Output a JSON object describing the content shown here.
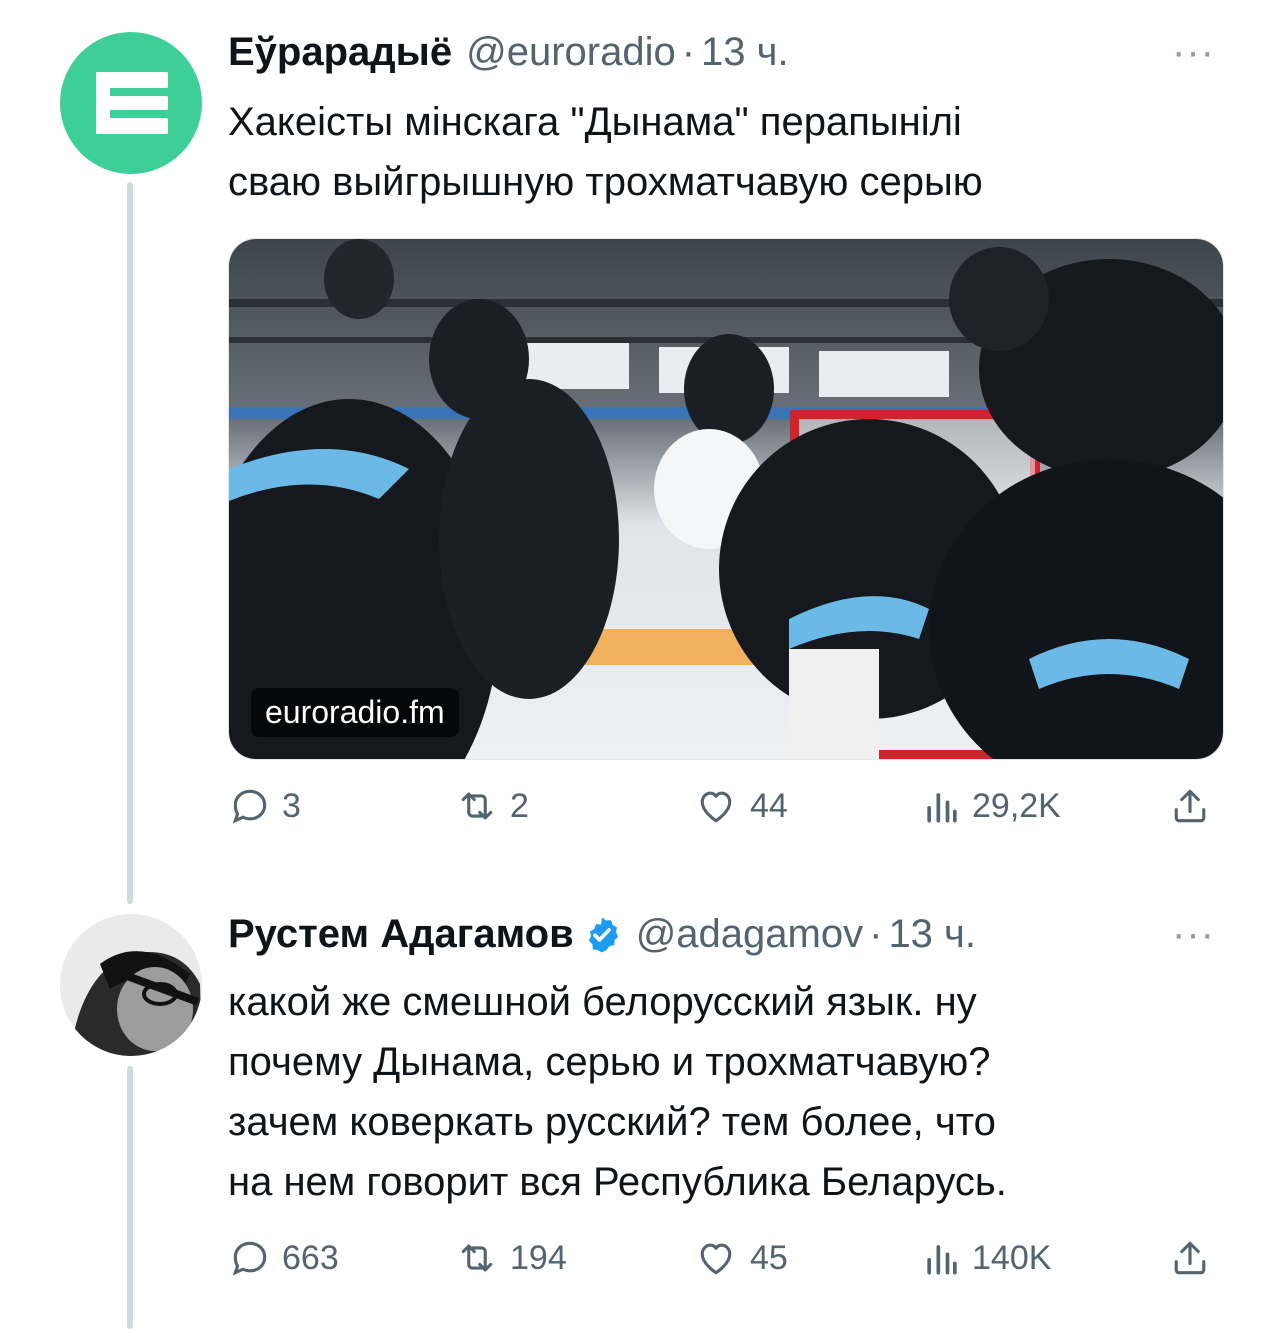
{
  "tweets": [
    {
      "display_name": "Еўрарадыё",
      "handle": "@euroradio",
      "separator": "·",
      "time": "13 ч.",
      "text": "Хакеісты мінскага \"Дынама\" перапынілі\nсваю выйгрышную трохматчавую серыю",
      "media": {
        "source_label": "euroradio.fm"
      },
      "actions": {
        "replies": "3",
        "retweets": "2",
        "likes": "44",
        "views": "29,2K"
      },
      "more_label": "···",
      "avatar_color": "#3ecf98"
    },
    {
      "display_name": "Рустем Адагамов",
      "handle": "@adagamov",
      "separator": "·",
      "time": "13 ч.",
      "text": "какой же смешной белорусский язык. ну\nпочему Дынама, серью и трохматчавую?\nзачем коверкать русский? тем более, что\nна нем говорит вся Республика Беларусь.",
      "verified_icon": "verified-badge-icon",
      "actions": {
        "replies": "663",
        "retweets": "194",
        "likes": "45",
        "views": "140K"
      },
      "more_label": "···"
    }
  ],
  "colors": {
    "accent": "#1d9bf0",
    "secondary_text": "#536471",
    "thread_line": "#cfd9de"
  }
}
